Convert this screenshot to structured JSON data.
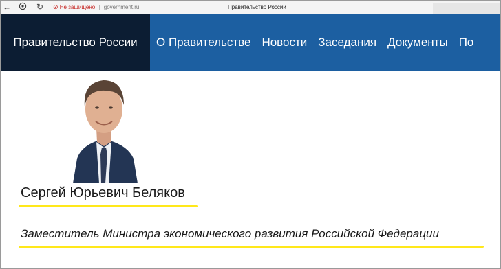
{
  "browser": {
    "security_warning": "Не защищено",
    "url": "government.ru",
    "tab_title": "Правительство России"
  },
  "site": {
    "brand": "Правительство России",
    "nav": [
      "О Правительстве",
      "Новости",
      "Заседания",
      "Документы",
      "По"
    ]
  },
  "profile": {
    "name": "Сергей Юрьевич Беляков",
    "position": "Заместитель Министра экономического развития Российской Федерации"
  },
  "colors": {
    "nav_background": "#1c5fa1",
    "brand_background": "#0c1d33",
    "highlight": "#ffe81a",
    "warning": "#c5221f"
  }
}
